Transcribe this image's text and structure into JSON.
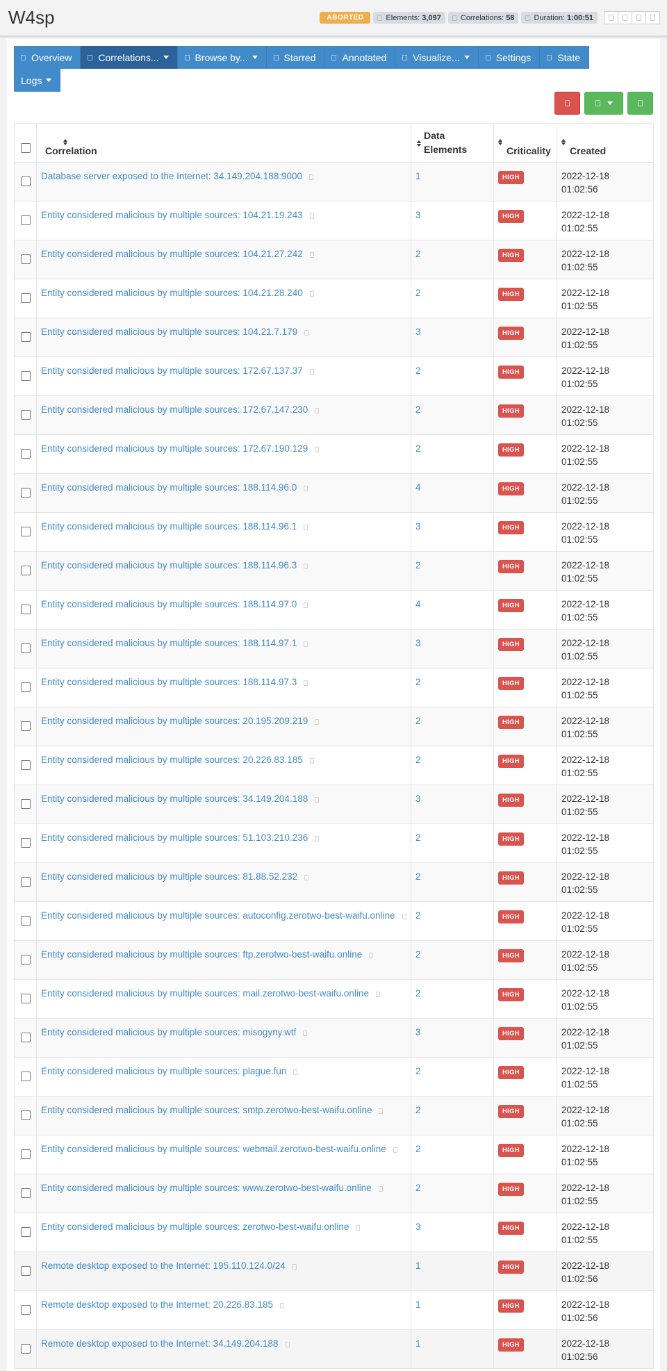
{
  "header": {
    "scan_name": "W4sp",
    "status": "ABORTED",
    "elements_label": "Elements:",
    "elements_value": "3,097",
    "correlations_label": "Correlations:",
    "correlations_value": "58",
    "duration_label": "Duration:",
    "duration_value": "1:00:51",
    "icon_buttons": [
      "refresh-icon",
      "export-icon",
      "download-icon",
      "delete-icon"
    ]
  },
  "nav": {
    "tabs": [
      {
        "label": "Overview",
        "dropdown": false,
        "active": false
      },
      {
        "label": "Correlations...",
        "dropdown": true,
        "active": true
      },
      {
        "label": "Browse by...",
        "dropdown": true,
        "active": false
      },
      {
        "label": "Starred",
        "dropdown": false,
        "active": false
      },
      {
        "label": "Annotated",
        "dropdown": false,
        "active": false
      },
      {
        "label": "Visualize...",
        "dropdown": true,
        "active": false
      },
      {
        "label": "Settings",
        "dropdown": false,
        "active": false
      },
      {
        "label": "State",
        "dropdown": false,
        "active": false
      },
      {
        "label": "Logs",
        "dropdown": true,
        "active": false
      }
    ]
  },
  "actions": {
    "colors": {
      "danger": "#d9534f",
      "success": "#5cb85c"
    },
    "buttons": [
      "delete-icon",
      "export-icon",
      "search-icon"
    ]
  },
  "table": {
    "columns": {
      "correlation": "Correlation",
      "data_elements_1": "Data",
      "data_elements_2": "Elements",
      "criticality": "Criticality",
      "created": "Created"
    },
    "rows": [
      {
        "correlation": "Database server exposed to the Internet: 34.149.204.188:9000",
        "count": "1",
        "criticality": "HIGH",
        "date": "2022-12-18",
        "time": "01:02:56"
      },
      {
        "correlation": "Entity considered malicious by multiple sources: 104.21.19.243",
        "count": "3",
        "criticality": "HIGH",
        "date": "2022-12-18",
        "time": "01:02:55"
      },
      {
        "correlation": "Entity considered malicious by multiple sources: 104.21.27.242",
        "count": "2",
        "criticality": "HIGH",
        "date": "2022-12-18",
        "time": "01:02:55"
      },
      {
        "correlation": "Entity considered malicious by multiple sources: 104.21.28.240",
        "count": "2",
        "criticality": "HIGH",
        "date": "2022-12-18",
        "time": "01:02:55"
      },
      {
        "correlation": "Entity considered malicious by multiple sources: 104.21.7.179",
        "count": "3",
        "criticality": "HIGH",
        "date": "2022-12-18",
        "time": "01:02:55"
      },
      {
        "correlation": "Entity considered malicious by multiple sources: 172.67.137.37",
        "count": "2",
        "criticality": "HIGH",
        "date": "2022-12-18",
        "time": "01:02:55"
      },
      {
        "correlation": "Entity considered malicious by multiple sources: 172.67.147.230",
        "count": "2",
        "criticality": "HIGH",
        "date": "2022-12-18",
        "time": "01:02:55"
      },
      {
        "correlation": "Entity considered malicious by multiple sources: 172.67.190.129",
        "count": "2",
        "criticality": "HIGH",
        "date": "2022-12-18",
        "time": "01:02:55"
      },
      {
        "correlation": "Entity considered malicious by multiple sources: 188.114.96.0",
        "count": "4",
        "criticality": "HIGH",
        "date": "2022-12-18",
        "time": "01:02:55"
      },
      {
        "correlation": "Entity considered malicious by multiple sources: 188.114.96.1",
        "count": "3",
        "criticality": "HIGH",
        "date": "2022-12-18",
        "time": "01:02:55"
      },
      {
        "correlation": "Entity considered malicious by multiple sources: 188.114.96.3",
        "count": "2",
        "criticality": "HIGH",
        "date": "2022-12-18",
        "time": "01:02:55"
      },
      {
        "correlation": "Entity considered malicious by multiple sources: 188.114.97.0",
        "count": "4",
        "criticality": "HIGH",
        "date": "2022-12-18",
        "time": "01:02:55"
      },
      {
        "correlation": "Entity considered malicious by multiple sources: 188.114.97.1",
        "count": "3",
        "criticality": "HIGH",
        "date": "2022-12-18",
        "time": "01:02:55"
      },
      {
        "correlation": "Entity considered malicious by multiple sources: 188.114.97.3",
        "count": "2",
        "criticality": "HIGH",
        "date": "2022-12-18",
        "time": "01:02:55"
      },
      {
        "correlation": "Entity considered malicious by multiple sources: 20.195.209.219",
        "count": "2",
        "criticality": "HIGH",
        "date": "2022-12-18",
        "time": "01:02:55"
      },
      {
        "correlation": "Entity considered malicious by multiple sources: 20.226.83.185",
        "count": "2",
        "criticality": "HIGH",
        "date": "2022-12-18",
        "time": "01:02:55"
      },
      {
        "correlation": "Entity considered malicious by multiple sources: 34.149.204.188",
        "count": "3",
        "criticality": "HIGH",
        "date": "2022-12-18",
        "time": "01:02:55"
      },
      {
        "correlation": "Entity considered malicious by multiple sources: 51.103.210.236",
        "count": "2",
        "criticality": "HIGH",
        "date": "2022-12-18",
        "time": "01:02:55"
      },
      {
        "correlation": "Entity considered malicious by multiple sources: 81.88.52.232",
        "count": "2",
        "criticality": "HIGH",
        "date": "2022-12-18",
        "time": "01:02:55"
      },
      {
        "correlation": "Entity considered malicious by multiple sources: autoconfig.zerotwo-best-waifu.online",
        "count": "2",
        "criticality": "HIGH",
        "date": "2022-12-18",
        "time": "01:02:55"
      },
      {
        "correlation": "Entity considered malicious by multiple sources: ftp.zerotwo-best-waifu.online",
        "count": "2",
        "criticality": "HIGH",
        "date": "2022-12-18",
        "time": "01:02:55"
      },
      {
        "correlation": "Entity considered malicious by multiple sources: mail.zerotwo-best-waifu.online",
        "count": "2",
        "criticality": "HIGH",
        "date": "2022-12-18",
        "time": "01:02:55"
      },
      {
        "correlation": "Entity considered malicious by multiple sources: misogyny.wtf",
        "count": "3",
        "criticality": "HIGH",
        "date": "2022-12-18",
        "time": "01:02:55"
      },
      {
        "correlation": "Entity considered malicious by multiple sources: plague.fun",
        "count": "2",
        "criticality": "HIGH",
        "date": "2022-12-18",
        "time": "01:02:55"
      },
      {
        "correlation": "Entity considered malicious by multiple sources: smtp.zerotwo-best-waifu.online",
        "count": "2",
        "criticality": "HIGH",
        "date": "2022-12-18",
        "time": "01:02:55"
      },
      {
        "correlation": "Entity considered malicious by multiple sources: webmail.zerotwo-best-waifu.online",
        "count": "2",
        "criticality": "HIGH",
        "date": "2022-12-18",
        "time": "01:02:55"
      },
      {
        "correlation": "Entity considered malicious by multiple sources: www.zerotwo-best-waifu.online",
        "count": "2",
        "criticality": "HIGH",
        "date": "2022-12-18",
        "time": "01:02:55"
      },
      {
        "correlation": "Entity considered malicious by multiple sources: zerotwo-best-waifu.online",
        "count": "3",
        "criticality": "HIGH",
        "date": "2022-12-18",
        "time": "01:02:55"
      },
      {
        "correlation": "Remote desktop exposed to the Internet: 195.110.124.0/24",
        "count": "1",
        "criticality": "HIGH",
        "date": "2022-12-18",
        "time": "01:02:56"
      },
      {
        "correlation": "Remote desktop exposed to the Internet: 20.226.83.185",
        "count": "1",
        "criticality": "HIGH",
        "date": "2022-12-18",
        "time": "01:02:56"
      },
      {
        "correlation": "Remote desktop exposed to the Internet: 34.149.204.188",
        "count": "1",
        "criticality": "HIGH",
        "date": "2022-12-18",
        "time": "01:02:56"
      }
    ]
  }
}
